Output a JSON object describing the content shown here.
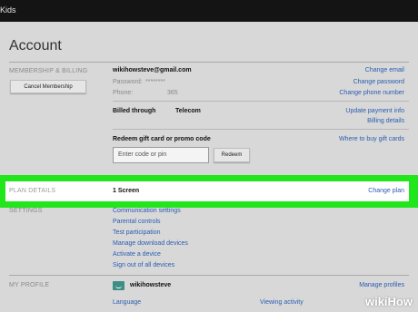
{
  "topbar": {
    "logo": "Kids"
  },
  "page_title": "Account",
  "membership": {
    "section_label": "MEMBERSHIP & BILLING",
    "cancel_button": "Cancel Membership",
    "email": "wikihowsteve@gmail.com",
    "password_label": "Password:",
    "password_value": "********",
    "phone_label": "Phone:",
    "phone_value": "365",
    "links": {
      "change_email": "Change email",
      "change_password": "Change password",
      "change_phone": "Change phone number",
      "update_payment": "Update payment info",
      "billing_details": "Billing details",
      "where_to_buy": "Where to buy gift cards"
    },
    "billed_through_label": "Billed through",
    "billed_through_value": "Telecom",
    "redeem_heading": "Redeem gift card or promo code",
    "redeem_placeholder": "Enter code or pin",
    "redeem_button": "Redeem"
  },
  "plan": {
    "section_label": "PLAN DETAILS",
    "value": "1 Screen",
    "change_plan": "Change plan"
  },
  "settings": {
    "section_label": "SETTINGS",
    "items": [
      "Communication settings",
      "Parental controls",
      "Test participation",
      "Manage download devices",
      "Activate a device",
      "Sign out of all devices"
    ]
  },
  "profile": {
    "section_label": "MY PROFILE",
    "name": "wikihowsteve",
    "manage_profiles": "Manage profiles",
    "language": "Language",
    "viewing_activity": "Viewing activity"
  },
  "watermark": {
    "wiki": "wiki",
    "how": "How"
  },
  "colors": {
    "highlight": "#22e61c",
    "link": "#2a5db0",
    "topbar": "#141414"
  }
}
